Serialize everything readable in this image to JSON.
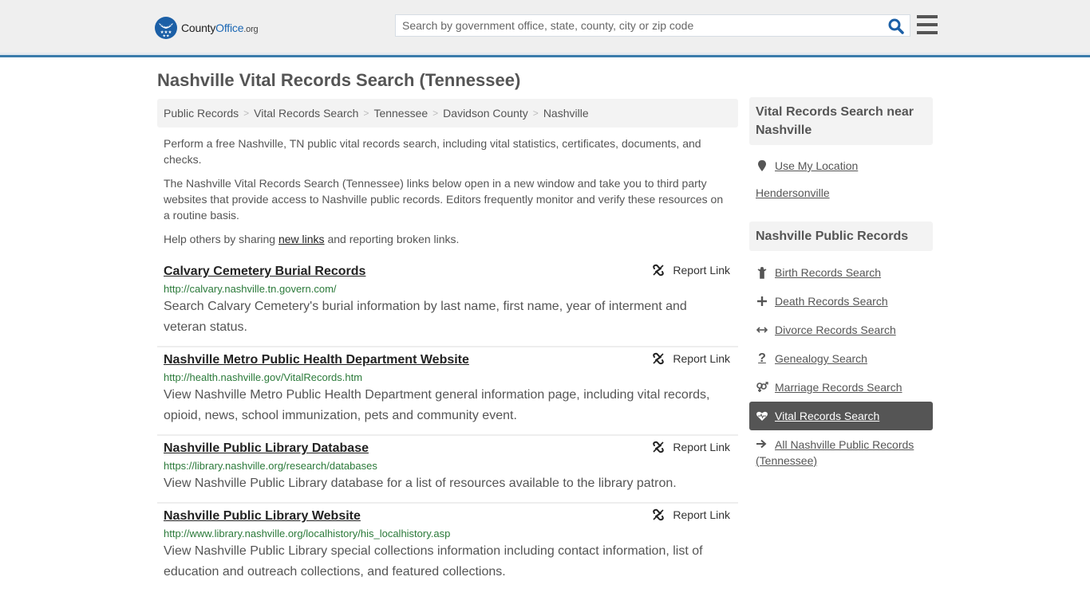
{
  "header": {
    "logo": {
      "county": "County",
      "office": "Office",
      "org": ".org"
    },
    "search": {
      "placeholder": "Search by government office, state, county, city or zip code",
      "value": ""
    },
    "icons": {
      "search": "search-icon",
      "menu": "hamburger-menu-icon"
    },
    "colors": {
      "accent_bar": "#3a7cab",
      "brand_blue": "#1b67b4"
    }
  },
  "page": {
    "title": "Nashville Vital Records Search (Tennessee)",
    "breadcrumb": [
      "Public Records",
      "Vital Records Search",
      "Tennessee",
      "Davidson County",
      "Nashville"
    ],
    "intro": {
      "p1": "Perform a free Nashville, TN public vital records search, including vital statistics, certificates, documents, and checks.",
      "p2": "The Nashville Vital Records Search (Tennessee) links below open in a new window and take you to third party websites that provide access to Nashville public records. Editors frequently monitor and verify these resources on a routine basis.",
      "p3_before": "Help others by sharing ",
      "p3_link": "new links",
      "p3_after": " and reporting broken links."
    }
  },
  "results": [
    {
      "title": "Calvary Cemetery Burial Records",
      "url": "http://calvary.nashville.tn.govern.com/",
      "description": "Search Calvary Cemetery's burial information by last name, first name, year of interment and veteran status.",
      "report_label": "Report Link"
    },
    {
      "title": "Nashville Metro Public Health Department Website",
      "url": "http://health.nashville.gov/VitalRecords.htm",
      "description": "View Nashville Metro Public Health Department general information page, including vital records, opioid, news, school immunization, pets and community event.",
      "report_label": "Report Link"
    },
    {
      "title": "Nashville Public Library Database",
      "url": "https://library.nashville.org/research/databases",
      "description": "View Nashville Public Library database for a list of resources available to the library patron.",
      "report_label": "Report Link"
    },
    {
      "title": "Nashville Public Library Website",
      "url": "http://www.library.nashville.org/localhistory/his_localhistory.asp",
      "description": "View Nashville Public Library special collections information including contact information, list of education and outreach collections, and featured collections.",
      "report_label": "Report Link"
    }
  ],
  "sidebar": {
    "near": {
      "heading": "Vital Records Search near Nashville",
      "use_location": "Use My Location",
      "cities": [
        "Hendersonville"
      ]
    },
    "public_records": {
      "heading": "Nashville Public Records",
      "items": [
        {
          "label": "Birth Records Search",
          "icon": "child-icon",
          "active": false
        },
        {
          "label": "Death Records Search",
          "icon": "cross-icon",
          "active": false
        },
        {
          "label": "Divorce Records Search",
          "icon": "arrows-horizontal-icon",
          "active": false
        },
        {
          "label": "Genealogy Search",
          "icon": "question-icon",
          "active": false
        },
        {
          "label": "Marriage Records Search",
          "icon": "venus-mars-icon",
          "active": false
        },
        {
          "label": "Vital Records Search",
          "icon": "heartbeat-icon",
          "active": true
        }
      ],
      "all_link": "All Nashville Public Records (Tennessee)"
    }
  }
}
